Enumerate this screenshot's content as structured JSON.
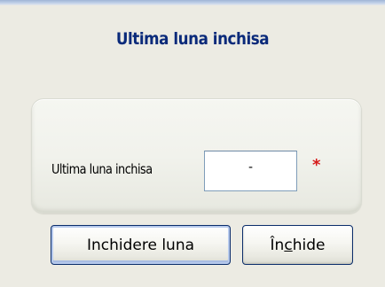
{
  "dialog": {
    "title": "Ultima luna inchisa"
  },
  "form": {
    "field_label": "Ultima luna inchisa",
    "field_value": "-",
    "required_marker": "*"
  },
  "buttons": {
    "close_month_label": "Inchidere luna",
    "close_label_prefix": "În",
    "close_label_mnemonic": "c",
    "close_label_suffix": "hide"
  },
  "colors": {
    "title_text": "#0a2a7a",
    "required_marker": "#d61a1a",
    "button_border": "#0b2d6b",
    "background": "#ecebe3"
  }
}
